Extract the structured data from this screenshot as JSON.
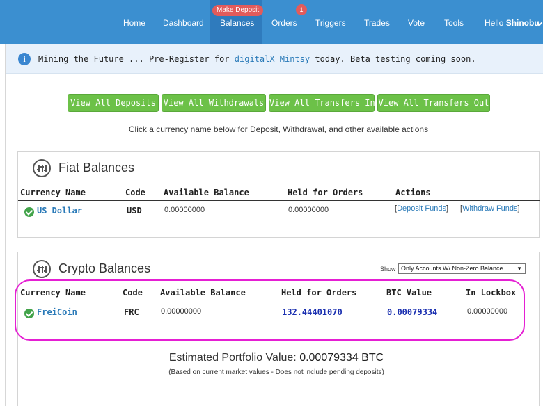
{
  "nav": {
    "items": [
      "Home",
      "Dashboard",
      "Balances",
      "Orders",
      "Triggers",
      "Trades",
      "Vote",
      "Tools"
    ],
    "make_deposit_badge": "Make Deposit",
    "orders_badge": "1",
    "hello_prefix": "Hello ",
    "username": "Shinobu",
    "active": "Balances",
    "colors": {
      "bar": "#3b8fd0",
      "active": "#2f7bbd",
      "badge": "#e25b5b"
    }
  },
  "banner": {
    "text_before": "Mining the Future ... Pre-Register for ",
    "link_text": "digitalX Mintsy",
    "text_after": " today. Beta testing coming soon.",
    "icon": "info-icon"
  },
  "buttons": [
    "View All Deposits",
    "View All Withdrawals",
    "View All Transfers In",
    "View All Transfers Out"
  ],
  "helper_text": "Click a currency name below for Deposit, Withdrawal, and other available actions",
  "fiat": {
    "title": "Fiat Balances",
    "headers": [
      "Currency Name",
      "Code",
      "Available Balance",
      "Held for Orders",
      "Actions"
    ],
    "rows": [
      {
        "name": "US Dollar",
        "code": "USD",
        "available": "0.00000000",
        "held": "0.00000000",
        "action_deposit": "Deposit Funds",
        "action_withdraw": "Withdraw Funds"
      }
    ]
  },
  "crypto": {
    "title": "Crypto Balances",
    "show_label": "Show",
    "filter_value": "Only Accounts W/ Non-Zero Balance",
    "headers": [
      "Currency Name",
      "Code",
      "Available Balance",
      "Held for Orders",
      "BTC Value",
      "In Lockbox"
    ],
    "rows": [
      {
        "name": "FreiCoin",
        "code": "FRC",
        "available": "0.00000000",
        "held": "132.44401070",
        "btc_value": "0.00079334",
        "lockbox": "0.00000000"
      }
    ]
  },
  "portfolio": {
    "label": "Estimated Portfolio Value: ",
    "value": "0.00079334 BTC",
    "note": "(Based on current market values - Does not include pending deposits)"
  },
  "colors": {
    "button": "#6cc148",
    "link": "#2a7ab8",
    "highlight": "#e51fd3",
    "value_blue": "#1a2fb0"
  }
}
